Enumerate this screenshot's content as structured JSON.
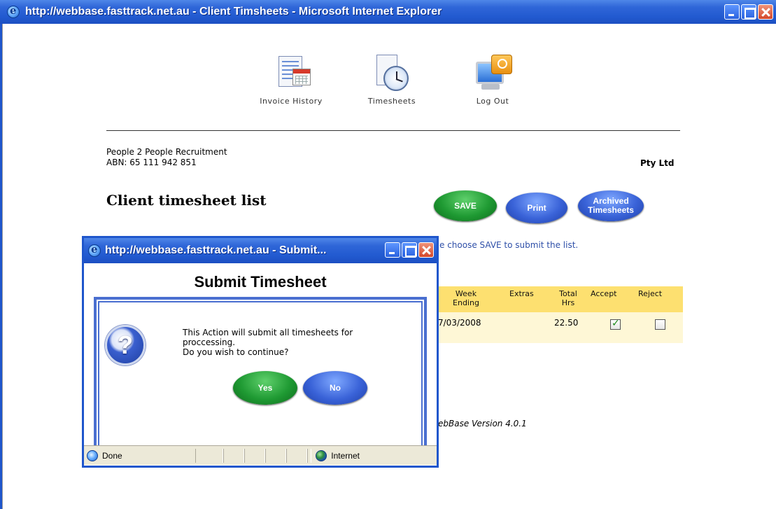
{
  "window": {
    "title": "http://webbase.fasttrack.net.au - Client Timsheets - Microsoft Internet Explorer"
  },
  "nav": {
    "items": [
      {
        "label": "Invoice History",
        "icon": "invoice-history-icon"
      },
      {
        "label": "Timesheets",
        "icon": "timesheets-clock-icon"
      },
      {
        "label": "Log Out",
        "icon": "logout-key-icon"
      }
    ]
  },
  "company": {
    "name": "People 2 People Recruitment",
    "abn": "ABN: 65 111 942 851",
    "suffix": "Pty Ltd"
  },
  "page": {
    "title": "Client timesheet list",
    "buttons": {
      "save": "SAVE",
      "print": "Print",
      "archived_line1": "Archived",
      "archived_line2": "Timesheets"
    },
    "instruction": "e choose SAVE to submit the list."
  },
  "table": {
    "headers": {
      "week_ending_1": "Week",
      "week_ending_2": "Ending",
      "extras": "Extras",
      "total_1": "Total",
      "total_2": "Hrs",
      "accept": "Accept",
      "reject": "Reject"
    },
    "rows": [
      {
        "week_ending": "7/03/2008",
        "extras": "",
        "total_hrs": "22.50",
        "accept": true,
        "reject": false
      }
    ]
  },
  "footer": {
    "version": "ebBase Version 4.0.1"
  },
  "popup": {
    "title": "http://webbase.fasttrack.net.au - Submit...",
    "heading": "Submit Timesheet",
    "message_line1": "This Action will submit all timesheets for",
    "message_line2": "proccessing.",
    "message_line3": "Do you wish to continue?",
    "yes": "Yes",
    "no": "No",
    "status_done": "Done",
    "status_zone": "Internet"
  },
  "colors": {
    "titlebar": "#225ad0",
    "table_header": "#fde070",
    "table_row": "#fef7d6",
    "save_button": "#1f9a33",
    "blue_button": "#3a63d8",
    "instruction_text": "#2e4fa8"
  }
}
